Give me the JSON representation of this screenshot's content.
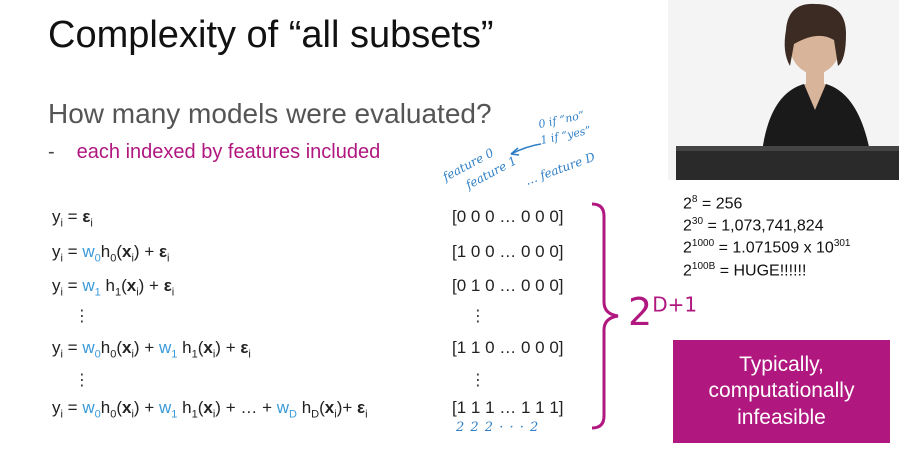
{
  "slide": {
    "title": "Complexity of “all subsets”",
    "question": "How many models were evaluated?",
    "bullet_dash": "-",
    "bullet_text": "each indexed by features included"
  },
  "equations": {
    "eq1": {
      "y": "y",
      "yi": "i",
      "eq": " = ",
      "eps": "ε",
      "epsi": "i"
    },
    "eq2": {
      "w0": "w",
      "w0s": "0",
      "h0": "h",
      "h0s": "0",
      "x": "x",
      "xs": "i",
      "plus": " + ",
      "eps": "ε",
      "epsi": "i"
    },
    "eq3": {
      "w1": "w",
      "w1s": "1",
      "h1": "h",
      "h1s": "1"
    },
    "eq4_mid": " + ",
    "eq6_mid": " + … + ",
    "wD": "w",
    "wDs": "D",
    "hD": "h",
    "hDs": "D",
    "vdots": "⋮"
  },
  "vectors": {
    "v1": "[0 0 0 … 0 0 0]",
    "v2": "[1 0 0 … 0 0 0]",
    "v3": "[0 1 0 … 0 0 0]",
    "v4": "[1 1 0 … 0 0 0]",
    "v5": "[1 1 1  …  1 1 1]",
    "vdots": "⋮"
  },
  "powers": {
    "p1_base": "2",
    "p1_exp": "8",
    "p1_val": " = 256",
    "p2_base": "2",
    "p2_exp": "30",
    "p2_val": " = 1,073,741,824",
    "p3_base": "2",
    "p3_exp": "1000",
    "p3_val": " = 1.071509 x 10",
    "p3_exp2": "301",
    "p4_base": "2",
    "p4_exp": "100B",
    "p4_val": " = HUGE!!!!!!"
  },
  "box": {
    "text": "Typically, computationally infeasible"
  },
  "annotations": {
    "feature0": "feature 0",
    "feature1": "feature 1",
    "featureD": "… feature D",
    "arrow_text_1": "0 if “no”",
    "arrow_text_2": "1 if “yes”",
    "count_base": "2",
    "count_exp": "D+1",
    "twos": "2 2 2 · · · 2"
  },
  "colors": {
    "accent_magenta": "#b0177f",
    "coef_blue": "#3a9ad9",
    "ink_blue": "#2f7fc7"
  }
}
